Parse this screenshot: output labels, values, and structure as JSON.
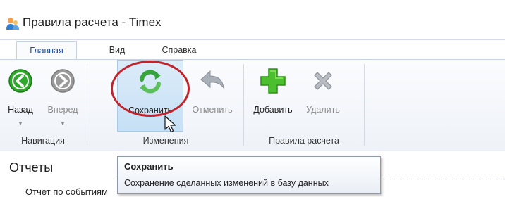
{
  "window": {
    "title": "Правила расчета - Timex",
    "icon": "people-app-icon"
  },
  "tabs": [
    {
      "label": "Главная",
      "active": true
    },
    {
      "label": "Вид",
      "active": false
    },
    {
      "label": "Справка",
      "active": false
    }
  ],
  "ribbon": {
    "navigation": {
      "label": "Навигация",
      "back": {
        "label": "Назад",
        "icon": "arrow-left-icon",
        "color": "#2fa82c"
      },
      "forward": {
        "label": "Вперед",
        "icon": "arrow-right-icon",
        "disabled": true
      }
    },
    "changes": {
      "label": "Изменения",
      "save": {
        "label": "Сохранить",
        "icon": "refresh-save-icon",
        "color": "#35a43b"
      },
      "cancel": {
        "label": "Отменить",
        "icon": "undo-icon",
        "disabled": true
      }
    },
    "rules": {
      "label": "Правила расчета",
      "add": {
        "label": "Добавить",
        "icon": "plus-icon",
        "color": "#4cbf2f"
      },
      "delete": {
        "label": "Удалить",
        "icon": "x-icon",
        "disabled": true
      }
    }
  },
  "content": {
    "section_title": "Отчеты",
    "items": [
      "Отчет по событиям"
    ]
  },
  "tooltip": {
    "title": "Сохранить",
    "description": "Сохранение сделанных изменений в базу данных"
  },
  "annotation": {
    "color": "#c0242c"
  }
}
